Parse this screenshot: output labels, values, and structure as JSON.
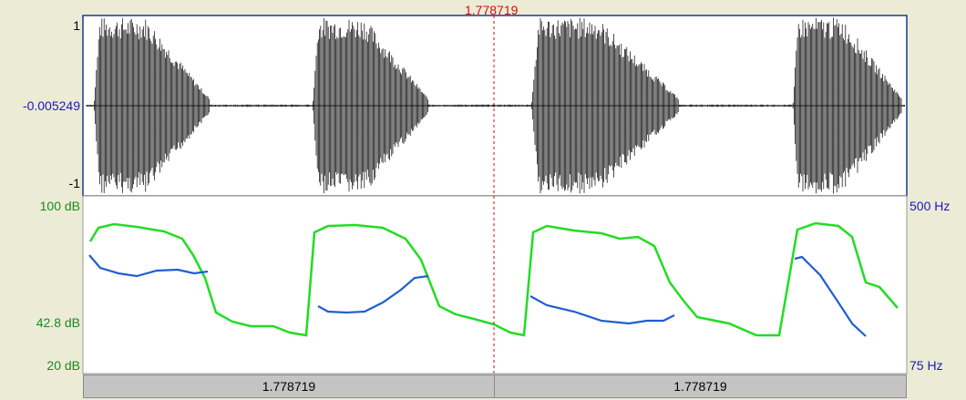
{
  "cursor": {
    "time": "1.778719"
  },
  "waveform": {
    "y_max_label": "1",
    "y_cursor_label": "-0.005249",
    "y_min_label": "-1"
  },
  "analysis": {
    "intensity_max": "100 dB",
    "intensity_cursor": "42.8 dB",
    "intensity_min": "20 dB",
    "pitch_max": "500 Hz",
    "pitch_min": "75 Hz"
  },
  "selection_bar": {
    "left_label": "1.778719",
    "right_label": "1.778719"
  },
  "colors": {
    "background": "#ecebd6",
    "waveform": "#000000",
    "intensity_curve": "#22dd22",
    "pitch_curve": "#1f5fd0",
    "cursor_line": "#d01010",
    "frame": "#1a3a8a"
  }
}
